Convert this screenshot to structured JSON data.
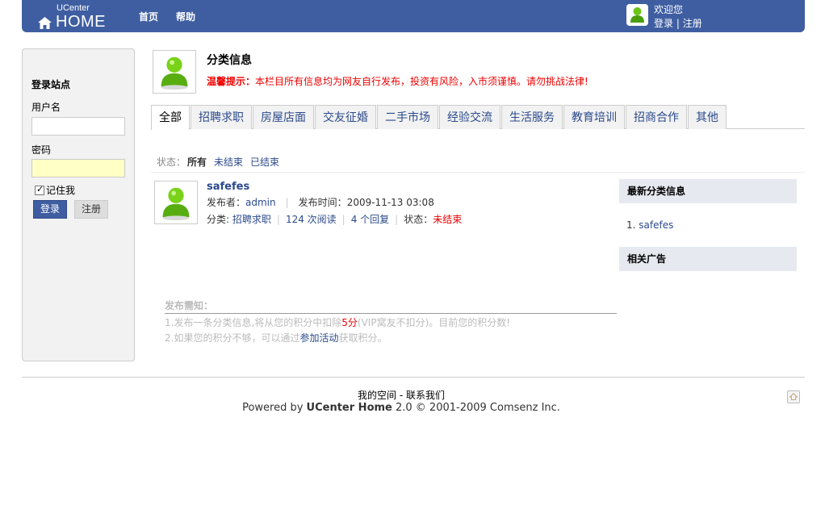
{
  "header": {
    "logo_top": "UCenter",
    "logo_main": "HOME",
    "nav": [
      "首页",
      "帮助"
    ],
    "welcome": "欢迎您",
    "login_link": "登录",
    "divider": "|",
    "register_link": "注册"
  },
  "login": {
    "title": "登录站点",
    "username_label": "用户名",
    "password_label": "密码",
    "remember_label": "记住我",
    "login_button": "登录",
    "register_button": "注册"
  },
  "page": {
    "title": "分类信息",
    "notice_label": "温馨提示：",
    "notice_text": "本栏目所有信息均为网友自行发布，投资有风险，入市须谨慎。请勿挑战法律!"
  },
  "tabs": [
    "全部",
    "招聘求职",
    "房屋店面",
    "交友征婚",
    "二手市场",
    "经验交流",
    "生活服务",
    "教育培训",
    "招商合作",
    "其他"
  ],
  "filter": {
    "label": "状态：",
    "options": [
      "所有",
      "未结束",
      "已结束"
    ]
  },
  "item": {
    "title": "safefes",
    "publisher_label": "发布者：",
    "publisher": "admin",
    "time_label": "发布时间：",
    "time": "2009-11-13 03:08",
    "category_label": "分类:",
    "category": "招聘求职",
    "reads": "124 次阅读",
    "replies": "4 个回复",
    "status_label": "状态：",
    "status": "未结束"
  },
  "sidebar": {
    "latest_title": "最新分类信息",
    "latest_items": [
      "1. safefes"
    ],
    "ads_title": "相关广告"
  },
  "post_notice": {
    "heading": "发布需知：",
    "line1_a": "1.发布一条分类信息,将从您的积分中扣除",
    "line1_points": "5分",
    "line1_b": "(VIP窝友不扣分)。目前您的积分数!",
    "line2_a": "2.如果您的积分不够，可以通过",
    "line2_link": "参加活动",
    "line2_b": "获取积分。"
  },
  "footer": {
    "link1": "我的空间",
    "link_sep": " - ",
    "link2": "联系我们",
    "powered": "Powered by ",
    "brand": "UCenter Home",
    "copy": " 2.0 © 2001-2009 Comsenz Inc."
  },
  "colors": {
    "header_bg": "#3f5ea1",
    "link": "#2b4a8c",
    "notice_red": "#e00000"
  }
}
